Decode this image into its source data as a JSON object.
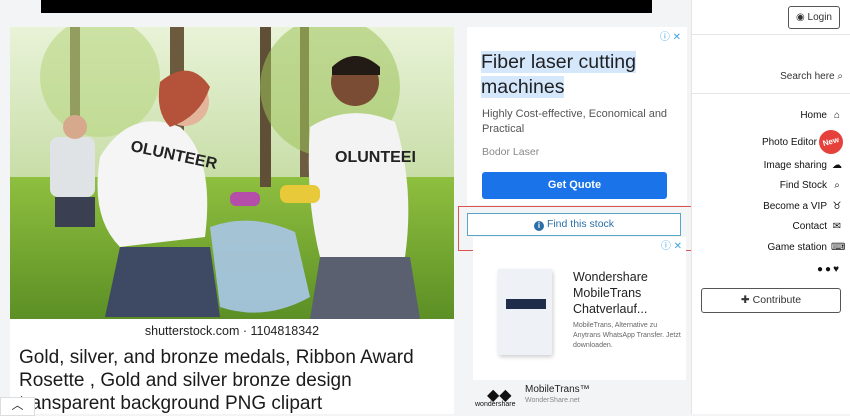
{
  "page": {
    "photo_caption": "shutterstock.com · 1104818342",
    "title": "Gold, silver, and bronze medals, Ribbon Award Rosette , Gold and silver bronze design transparent background PNG clipart"
  },
  "icons": {
    "scroll_up": "chevron-up-icon",
    "adchoices": "adchoices-icon"
  },
  "ad1": {
    "adchoices": "ⓘ ✕",
    "headline_line1": "Fiber laser cutting",
    "headline_line2": "machines",
    "description": "Highly Cost-effective, Economical and Practical",
    "brand": "Bodor Laser",
    "cta": "Get Quote"
  },
  "find_stock": {
    "label": "Find this stock"
  },
  "ad2": {
    "adchoices": "ⓘ ✕",
    "title": "Wondershare MobileTrans Chatverlauf...",
    "description": "MobileTrans, Alternative zu Anytrans WhatsApp Transfer. Jetzt downloaden."
  },
  "ad3": {
    "logo_text": "wondershare",
    "name": "MobileTrans™",
    "site": "WonderShare.net"
  },
  "sidebar": {
    "login": "Login",
    "search": "Search here",
    "menu": [
      {
        "label": "Home",
        "icon": "home-icon"
      },
      {
        "label": "Photo Editor",
        "icon": "new-badge",
        "badge": "New"
      },
      {
        "label": "Image sharing",
        "icon": "cloud-upload-icon"
      },
      {
        "label": "Find Stock",
        "icon": "search-icon"
      },
      {
        "label": "Become a VIP",
        "icon": "medal-icon"
      },
      {
        "label": "Contact",
        "icon": "mail-icon"
      },
      {
        "label": "Game station",
        "icon": "gamepad-icon"
      }
    ],
    "social": [
      "facebook-icon",
      "reddit-icon",
      "twitter-icon"
    ],
    "contribute": "Contribute"
  },
  "colors": {
    "accent": "#1a73e8",
    "highlight_border": "#d9534f",
    "badge": "#e5403a"
  }
}
